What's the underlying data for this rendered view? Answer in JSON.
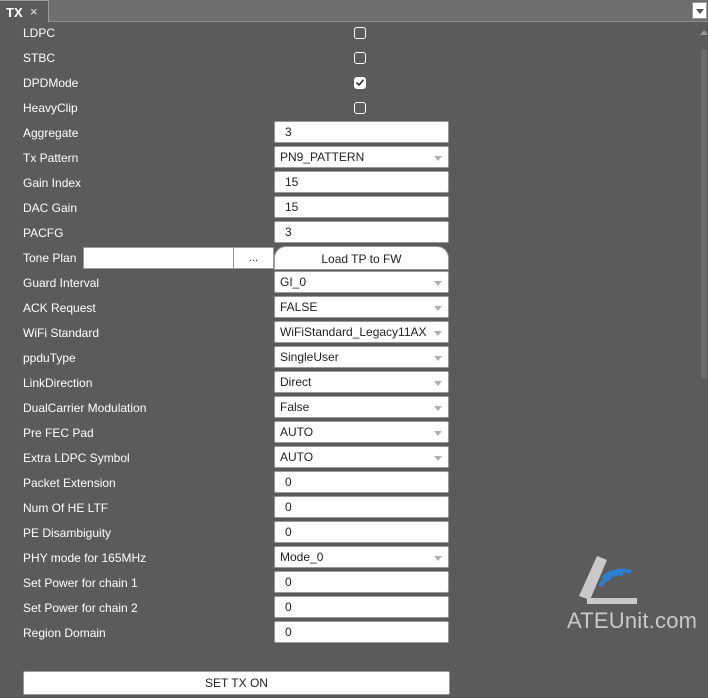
{
  "tab": {
    "title": "TX",
    "close_glyph": "×"
  },
  "colors": {
    "background": "#5b5b5b",
    "field_bg": "#ffffff",
    "tab_bar": "#6e6e6e"
  },
  "flags": [
    {
      "label": "LDPC",
      "checked": false
    },
    {
      "label": "STBC",
      "checked": false
    },
    {
      "label": "DPDMode",
      "checked": true
    },
    {
      "label": "HeavyClip",
      "checked": false
    }
  ],
  "fields": {
    "aggregate": {
      "label": "Aggregate",
      "value": "3"
    },
    "tx_pattern": {
      "label": "Tx Pattern",
      "value": "PN9_PATTERN"
    },
    "gain_index": {
      "label": "Gain Index",
      "value": "15"
    },
    "dac_gain": {
      "label": "DAC Gain",
      "value": "15"
    },
    "pacfg": {
      "label": "PACFG",
      "value": "3"
    },
    "tone_plan": {
      "label": "Tone Plan",
      "value": "",
      "browse_label": "...",
      "load_label": "Load TP to FW"
    },
    "guard_interval": {
      "label": "Guard Interval",
      "value": "GI_0"
    },
    "ack_request": {
      "label": "ACK Request",
      "value": "FALSE"
    },
    "wifi_standard": {
      "label": "WiFi Standard",
      "value": "WiFiStandard_Legacy11AX"
    },
    "ppdu_type": {
      "label": "ppduType",
      "value": "SingleUser"
    },
    "link_direction": {
      "label": "LinkDirection",
      "value": "Direct"
    },
    "dual_carrier": {
      "label": "DualCarrier Modulation",
      "value": "False"
    },
    "pre_fec_pad": {
      "label": "Pre FEC Pad",
      "value": "AUTO"
    },
    "extra_ldpc": {
      "label": "Extra LDPC Symbol",
      "value": "AUTO"
    },
    "packet_extension": {
      "label": "Packet Extension",
      "value": "0"
    },
    "num_he_ltf": {
      "label": "Num Of HE LTF",
      "value": "0"
    },
    "pe_disambiguity": {
      "label": "PE Disambiguity",
      "value": "0"
    },
    "phy_mode_165": {
      "label": "PHY mode for 165MHz",
      "value": "Mode_0"
    },
    "power_chain1": {
      "label": "Set Power for chain 1",
      "value": "0"
    },
    "power_chain2": {
      "label": "Set Power for chain 2",
      "value": "0"
    },
    "region_domain": {
      "label": "Region Domain",
      "value": "0"
    }
  },
  "actions": {
    "set_tx_on": "SET TX ON"
  },
  "watermark": {
    "text": "ATEUnit.com"
  }
}
